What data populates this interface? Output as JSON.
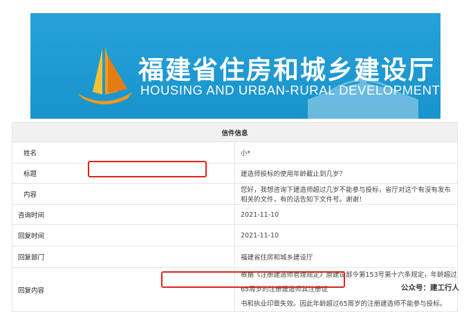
{
  "banner": {
    "title": "福建省住房和城乡建设厅",
    "subtitle": "HOUSING AND URBAN-RURAL DEVELOPMENT OF FUJIAN",
    "bg_color": "#1a9bd7",
    "logo_icon": "sail-building-logo-icon"
  },
  "letter": {
    "header": "信件信息",
    "rows": [
      {
        "label": "姓名",
        "value": "小*"
      },
      {
        "label": "标题",
        "value": "建造师投标的使用年龄截止到几岁？"
      },
      {
        "label": "内容",
        "value": "您好，我想咨询下建造师超过几岁不能参与投标，省厅对这个有没有发布相关的文件，有的话告知下文件号。谢谢！"
      },
      {
        "label": "咨询时间",
        "value": "2021-11-10"
      },
      {
        "label": "回复时间",
        "value": "2021-11-10"
      },
      {
        "label": "回复部门",
        "value": "福建省住房和城乡建设厅"
      },
      {
        "label": "回复内容",
        "value_line1": "根据《注册建造师管理规定》原建设部令第153号第十六条规定，年龄超过65周岁的注册建造师其注册证",
        "value_line2_a": "书和执业印章失效。",
        "value_line2_b": "因此年龄超过65周岁的注册建造师不能参与投标。"
      }
    ]
  },
  "highlight_color": "#e0201b",
  "watermark": "公众号：建工行人"
}
